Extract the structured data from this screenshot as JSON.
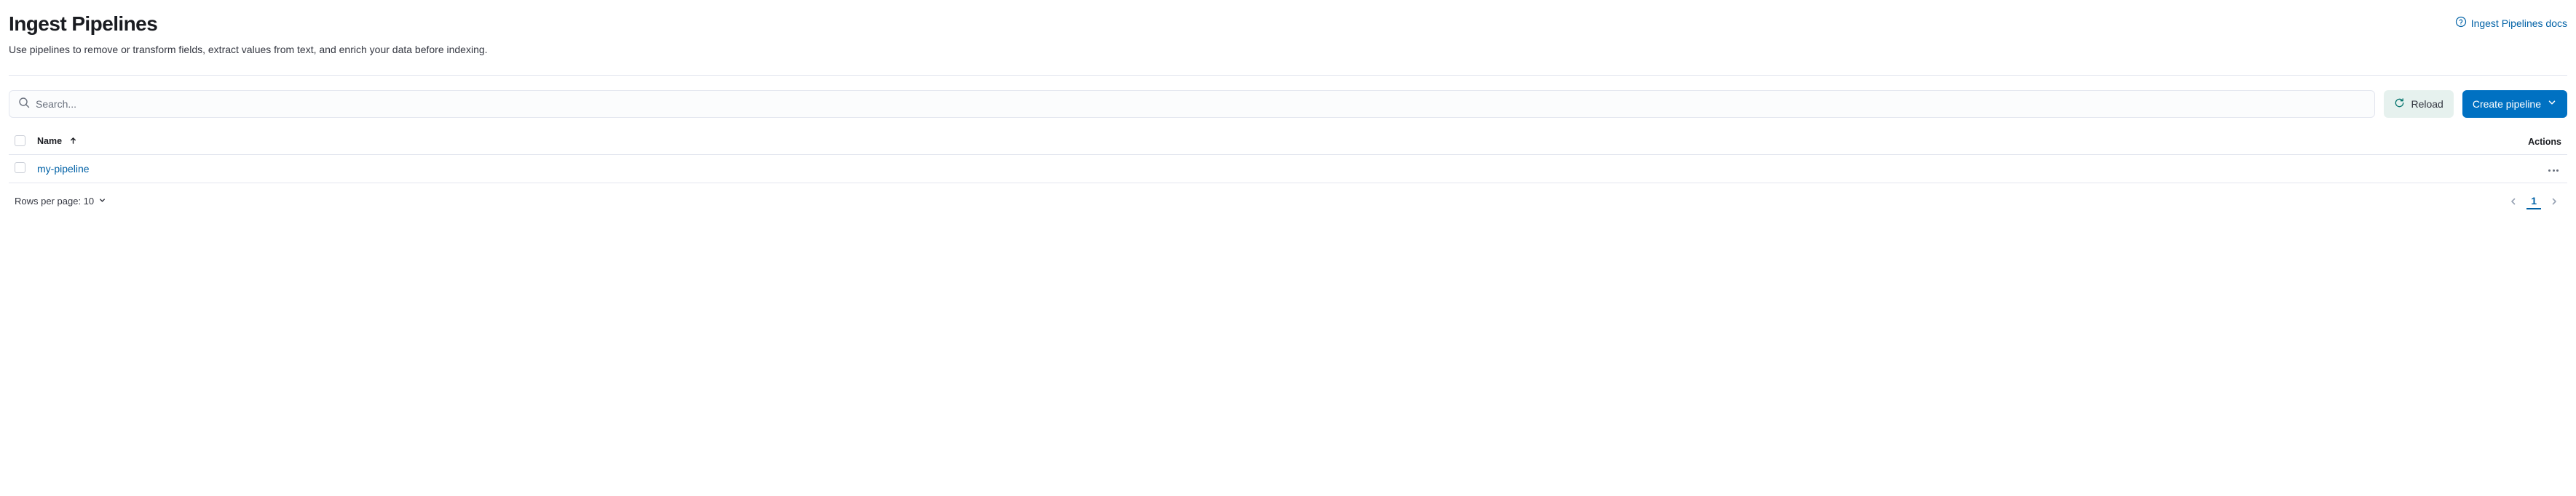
{
  "header": {
    "title": "Ingest Pipelines",
    "docs_link": "Ingest Pipelines docs",
    "description": "Use pipelines to remove or transform fields, extract values from text, and enrich your data before indexing."
  },
  "toolbar": {
    "search_placeholder": "Search...",
    "reload_label": "Reload",
    "create_label": "Create pipeline"
  },
  "table": {
    "columns": {
      "name": "Name",
      "actions": "Actions"
    },
    "rows": [
      {
        "name": "my-pipeline"
      }
    ]
  },
  "footer": {
    "rows_label": "Rows per page: 10",
    "current_page": "1"
  }
}
